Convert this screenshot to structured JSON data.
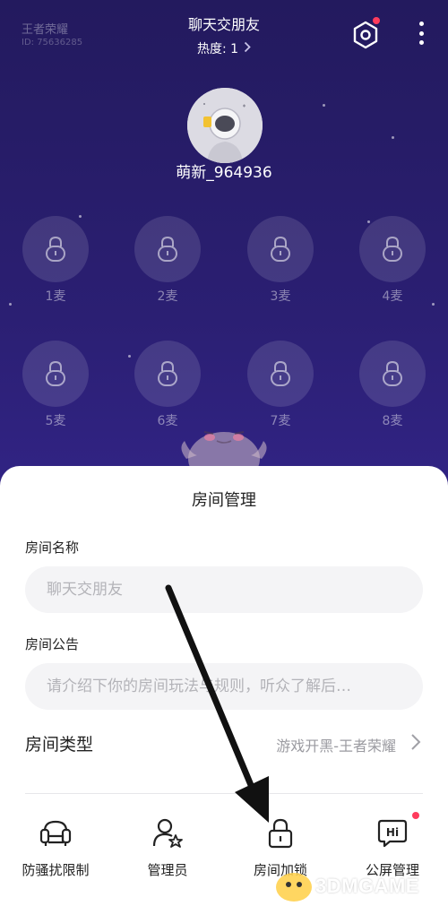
{
  "header": {
    "game_name": "王者荣耀",
    "room_id": "ID: 75636285",
    "room_title": "聊天交朋友",
    "heat_label": "热度: 1",
    "settings_icon": "settings-hex-icon",
    "more_icon": "more-vertical-icon",
    "settings_badge_color": "#ff3b5c"
  },
  "host": {
    "name": "萌新_964936",
    "avatar_icon": "astronaut-avatar"
  },
  "seats": [
    {
      "label": "1麦",
      "locked": true
    },
    {
      "label": "2麦",
      "locked": true
    },
    {
      "label": "3麦",
      "locked": true
    },
    {
      "label": "4麦",
      "locked": true
    },
    {
      "label": "5麦",
      "locked": true
    },
    {
      "label": "6麦",
      "locked": true
    },
    {
      "label": "7麦",
      "locked": true
    },
    {
      "label": "8麦",
      "locked": true
    }
  ],
  "sheet": {
    "title": "房间管理",
    "name_label": "房间名称",
    "name_value": "聊天交朋友",
    "notice_label": "房间公告",
    "notice_placeholder": "请介绍下你的房间玩法与规则，听众了解后…",
    "type_label": "房间类型",
    "type_value": "游戏开黑-王者荣耀",
    "actions": [
      {
        "label": "防骚扰限制",
        "icon": "sofa-shield-icon"
      },
      {
        "label": "管理员",
        "icon": "user-star-icon"
      },
      {
        "label": "房间加锁",
        "icon": "lock-icon"
      },
      {
        "label": "公屏管理",
        "icon": "hi-chat-icon",
        "badge": true
      }
    ]
  },
  "watermark": {
    "text": "3DMGAME"
  },
  "colors": {
    "background_top": "#231a5e",
    "background_bottom": "#3a2a96",
    "accent_red": "#ff3b5c",
    "sheet_bg": "#ffffff"
  }
}
